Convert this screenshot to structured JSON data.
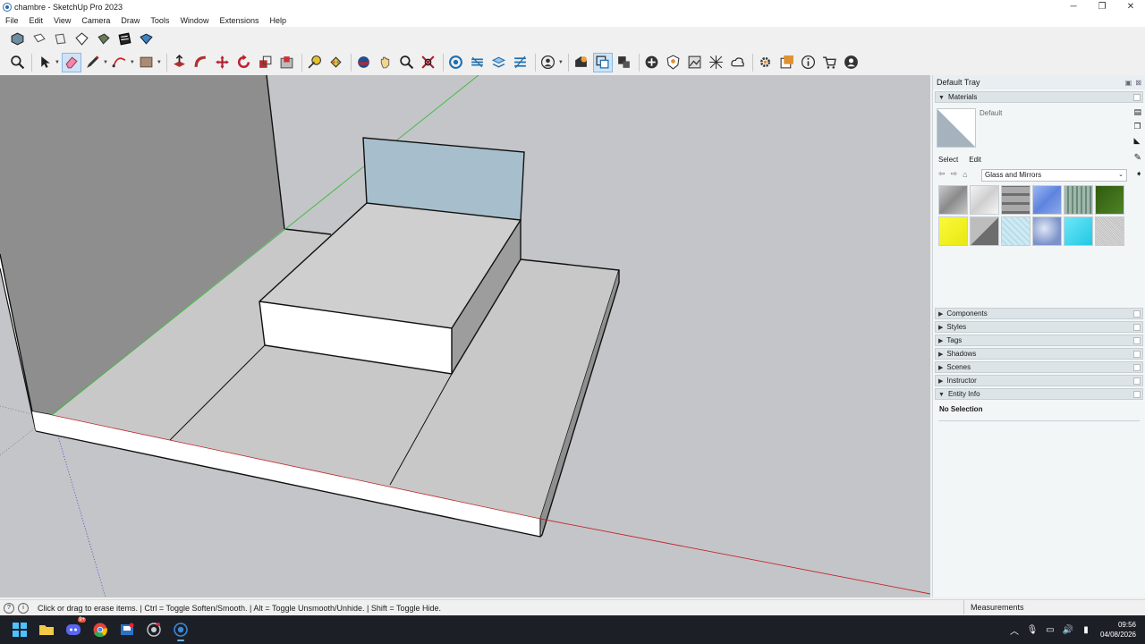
{
  "window": {
    "title": "chambre - SketchUp Pro 2023",
    "minimize": "─",
    "maximize": "❐",
    "close": "✕"
  },
  "menu": [
    "File",
    "Edit",
    "View",
    "Camera",
    "Draw",
    "Tools",
    "Window",
    "Extensions",
    "Help"
  ],
  "toolbar_top": [
    {
      "name": "iso-view-icon"
    },
    {
      "name": "top-view-icon"
    },
    {
      "name": "front-view-icon"
    },
    {
      "name": "right-view-icon"
    },
    {
      "name": "back-view-icon"
    },
    {
      "name": "left-view-icon"
    },
    {
      "name": "bottom-view-icon"
    }
  ],
  "toolbar_main_active": "eraser-tool",
  "tray": {
    "title": "Default Tray",
    "materials": {
      "header": "Materials",
      "current_material": "Default",
      "tabs": [
        "Select",
        "Edit"
      ],
      "selected_tab": "Select",
      "library": "Glass and Mirrors",
      "swatch_colors": [
        "#9a9a9a",
        "#d9d9d9",
        "#7e7e7e",
        "#6d8fe0",
        "#8aa59a",
        "#3e6b1a",
        "#f3f51d",
        "#8c8c8c",
        "#c8e6ef",
        "#8fa4d6",
        "#3fd2ec",
        "#c9c9c9"
      ]
    },
    "panels": [
      "Components",
      "Styles",
      "Tags",
      "Shadows",
      "Scenes",
      "Instructor"
    ],
    "entity_info": {
      "header": "Entity Info",
      "body": "No Selection"
    }
  },
  "status": {
    "text": "Click or drag to erase items. | Ctrl = Toggle Soften/Smooth. | Alt = Toggle Unsmooth/Unhide. | Shift = Toggle Hide.",
    "measurements_label": "Measurements"
  },
  "taskbar": {
    "time": "09:56",
    "date": "04/08/2026",
    "discord_badge": "9+"
  },
  "colors": {
    "viewport_bg": "#c4c5c9",
    "glass_panel": "#a7bfcc",
    "red_axis": "#c0282b",
    "green_axis": "#3fb83f",
    "blue_axis": "#3a3ac8"
  }
}
